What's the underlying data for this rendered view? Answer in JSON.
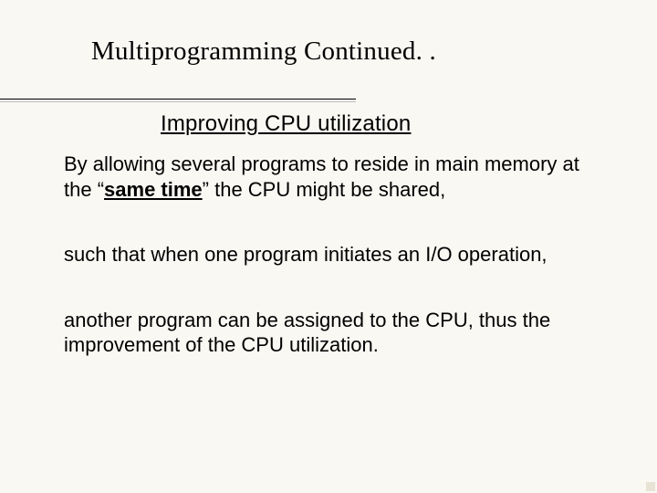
{
  "title": "Multiprogramming Continued. .",
  "subtitle": "Improving CPU utilization",
  "body": {
    "p1_pre": "By allowing several programs to reside in  main memory at the “",
    "p1_emph": "same time",
    "p1_post": "” the CPU might be shared,",
    "p2": "such that when one program initiates an I/O operation,",
    "p3": "another program can be assigned to the CPU, thus the improvement of the CPU utilization."
  }
}
